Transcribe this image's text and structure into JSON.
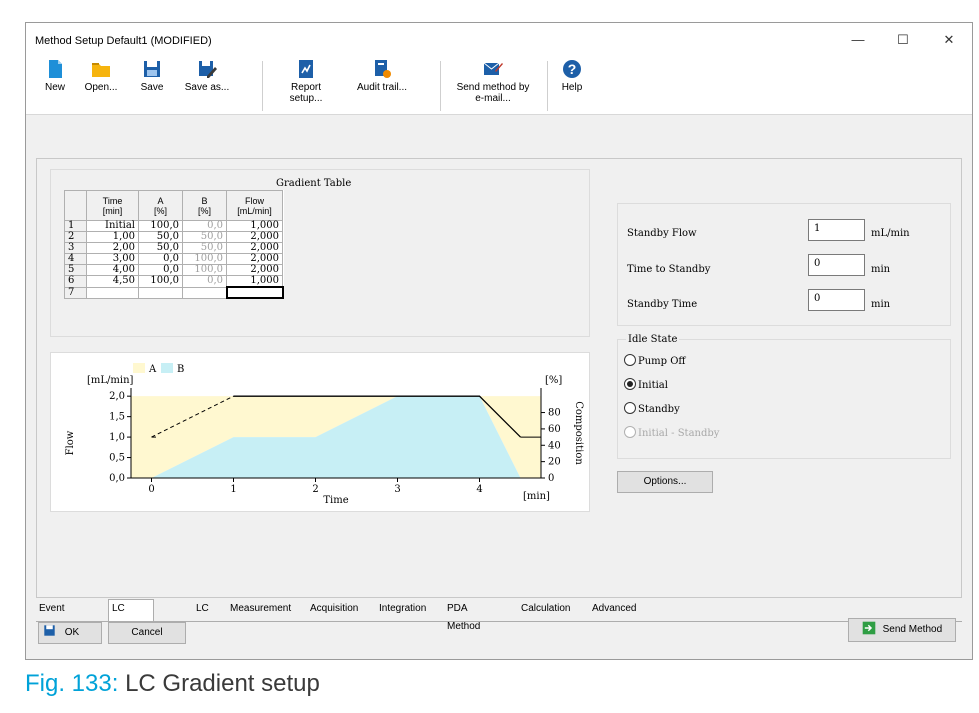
{
  "window": {
    "title": "Method Setup Default1 (MODIFIED)",
    "minimize": "—",
    "maximize": "☐",
    "close": "✕"
  },
  "toolbar": {
    "new": "New",
    "open": "Open...",
    "save": "Save",
    "save_as": "Save as...",
    "report_setup": "Report setup...",
    "audit_trail": "Audit trail...",
    "send_method_by": "Send method by",
    "send_method_email": "e-mail...",
    "help": "Help"
  },
  "gradient_table": {
    "title": "Gradient Table",
    "headers": [
      {
        "line1": "Time",
        "line2": "[min]"
      },
      {
        "line1": "A",
        "line2": "[%]"
      },
      {
        "line1": "B",
        "line2": "[%]"
      },
      {
        "line1": "Flow",
        "line2": "[mL/min]"
      }
    ],
    "rows": [
      {
        "n": "1",
        "time": "Initial",
        "a": "100,0",
        "b": "0,0",
        "flow": "1,000"
      },
      {
        "n": "2",
        "time": "1,00",
        "a": "50,0",
        "b": "50,0",
        "flow": "2,000"
      },
      {
        "n": "3",
        "time": "2,00",
        "a": "50,0",
        "b": "50,0",
        "flow": "2,000"
      },
      {
        "n": "4",
        "time": "3,00",
        "a": "0,0",
        "b": "100,0",
        "flow": "2,000"
      },
      {
        "n": "5",
        "time": "4,00",
        "a": "0,0",
        "b": "100,0",
        "flow": "2,000"
      },
      {
        "n": "6",
        "time": "4,50",
        "a": "100,0",
        "b": "0,0",
        "flow": "1,000"
      },
      {
        "n": "7",
        "time": "",
        "a": "",
        "b": "",
        "flow": ""
      }
    ]
  },
  "chart_data": {
    "type": "area",
    "legend": [
      "A",
      "B"
    ],
    "colors": {
      "A": "#fff8d0",
      "B": "#c7eff5",
      "flow_line": "#000000"
    },
    "x": [
      0,
      1,
      2,
      3,
      4,
      4.5
    ],
    "xticks": [
      "0",
      "1",
      "2",
      "3",
      "4"
    ],
    "xlabel": "Time",
    "xunit": "[min]",
    "xlim": [
      -0.25,
      4.75
    ],
    "series": [
      {
        "name": "A",
        "values": [
          100,
          50,
          50,
          0,
          0,
          100
        ]
      },
      {
        "name": "B",
        "values": [
          0,
          50,
          50,
          100,
          100,
          0
        ]
      }
    ],
    "flow": [
      1.0,
      2.0,
      2.0,
      2.0,
      2.0,
      1.0
    ],
    "ylabel_left": "Flow",
    "yunit_left": "[mL/min]",
    "yticks_left": [
      "0,0",
      "0,5",
      "1,0",
      "1,5",
      "2,0"
    ],
    "ylim_left": [
      0,
      2.2
    ],
    "ylabel_right": "Composition",
    "yunit_right": "[%]",
    "yticks_right": [
      "0",
      "20",
      "40",
      "60",
      "80"
    ],
    "ylim_right": [
      0,
      110
    ]
  },
  "standby": {
    "flow_label": "Standby Flow",
    "flow_value": "1",
    "flow_unit": "mL/min",
    "time_to_label": "Time to Standby",
    "time_to_value": "0",
    "time_to_unit": "min",
    "time_label": "Standby Time",
    "time_value": "0",
    "time_unit": "min"
  },
  "idle_state": {
    "title": "Idle State",
    "options": [
      "Pump Off",
      "Initial",
      "Standby",
      "Initial - Standby"
    ],
    "selected": "Initial"
  },
  "options_button": "Options...",
  "tabs": [
    "Event Table",
    "LC Gradient",
    "LC",
    "Measurement",
    "Acquisition",
    "Integration",
    "PDA Method",
    "Calculation",
    "Advanced"
  ],
  "active_tab": "LC Gradient",
  "footer": {
    "ok": "OK",
    "cancel": "Cancel",
    "send_method": "Send Method"
  },
  "caption": {
    "fig": "Fig. 133:",
    "text": "LC Gradient setup"
  }
}
